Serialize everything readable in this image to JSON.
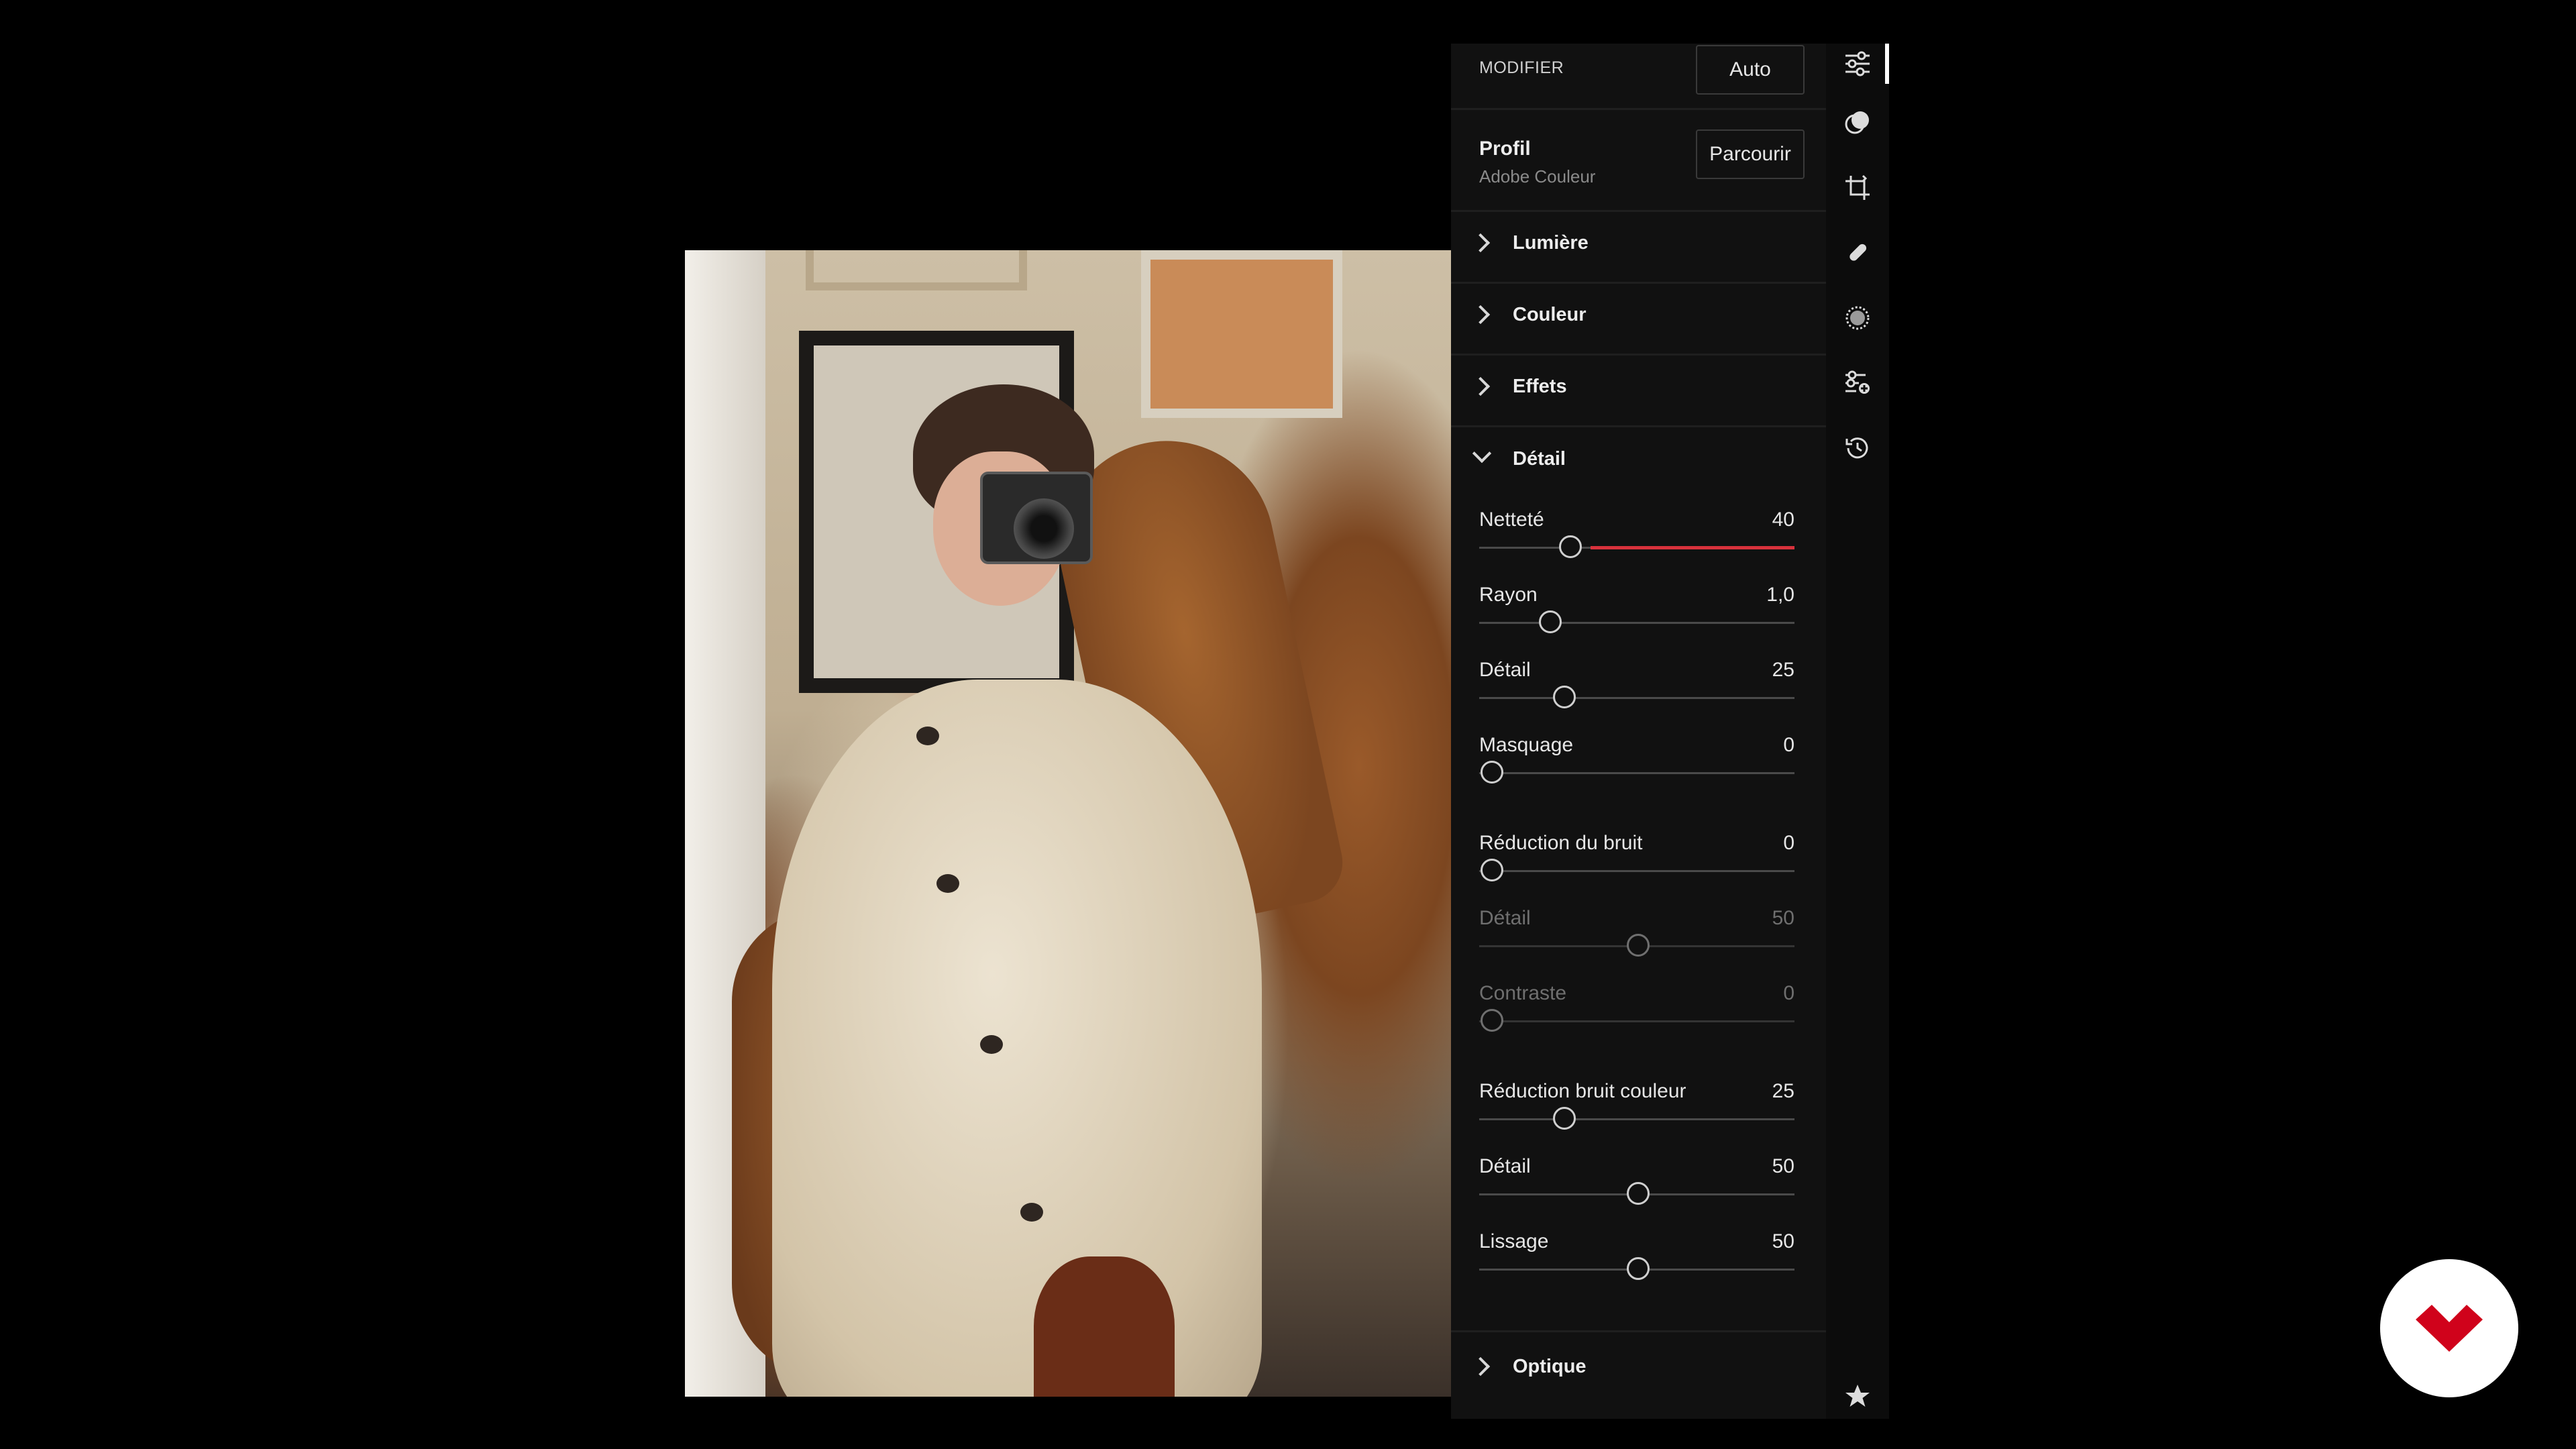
{
  "header": {
    "label": "MODIFIER",
    "auto_button": "Auto"
  },
  "profile": {
    "title": "Profil",
    "value": "Adobe Couleur",
    "browse_button": "Parcourir"
  },
  "sections": {
    "light": "Lumière",
    "color": "Couleur",
    "effects": "Effets",
    "detail": "Détail",
    "optics": "Optique"
  },
  "detail_sliders": [
    {
      "label": "Netteté",
      "value": "40",
      "fraction": 0.29,
      "enabled": true,
      "accent": "#d9323c"
    },
    {
      "label": "Rayon",
      "value": "1,0",
      "fraction": 0.225,
      "enabled": true
    },
    {
      "label": "Détail",
      "value": "25",
      "fraction": 0.27,
      "enabled": true
    },
    {
      "label": "Masquage",
      "value": "0",
      "fraction": 0.04,
      "enabled": true
    }
  ],
  "noise_sliders": [
    {
      "label": "Réduction du bruit",
      "value": "0",
      "fraction": 0.04,
      "enabled": true
    },
    {
      "label": "Détail",
      "value": "50",
      "fraction": 0.505,
      "enabled": false
    },
    {
      "label": "Contraste",
      "value": "0",
      "fraction": 0.04,
      "enabled": false
    }
  ],
  "color_noise_sliders": [
    {
      "label": "Réduction bruit couleur",
      "value": "25",
      "fraction": 0.27,
      "enabled": true
    },
    {
      "label": "Détail",
      "value": "50",
      "fraction": 0.505,
      "enabled": true
    },
    {
      "label": "Lissage",
      "value": "50",
      "fraction": 0.505,
      "enabled": true
    }
  ],
  "tools": [
    "edit-sliders-icon",
    "masking-icon",
    "crop-icon",
    "healing-icon",
    "vignette-icon",
    "presets-icon",
    "history-icon",
    "star-icon"
  ],
  "brand_color": "#d0021b"
}
